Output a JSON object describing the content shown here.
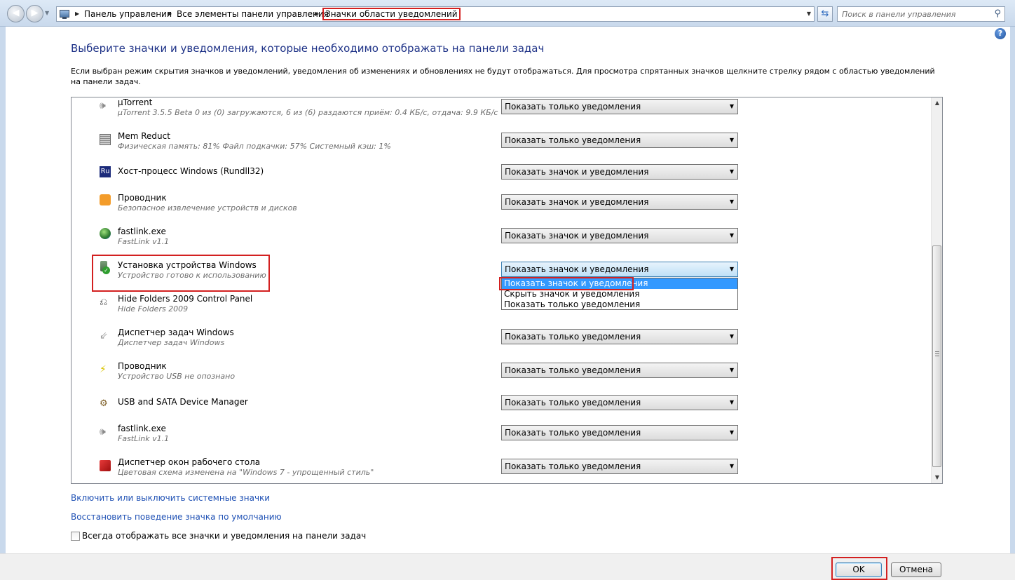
{
  "address": {
    "crumbs": [
      "Панель управления",
      "Все элементы панели управления",
      "Значки области уведомлений"
    ],
    "search_placeholder": "Поиск в панели управления"
  },
  "page": {
    "title": "Выберите значки и уведомления, которые необходимо отображать на панели задач",
    "description": "Если выбран режим скрытия значков и уведомлений, уведомления об изменениях и обновлениях не будут отображаться. Для просмотра спрятанных значков щелкните стрелку рядом с областью уведомлений на панели задач."
  },
  "rows": [
    {
      "name": "µTorrent",
      "sub": "µTorrent 3.5.5 Beta  0 из (0) загружаются, 6 из (6) раздаются  приём: 0.4 КБ/с, отдача: 9.9 КБ/с",
      "value": "Показать только уведомления",
      "icon": "speaker-icon"
    },
    {
      "name": "Mem Reduct",
      "sub": "Физическая память: 81%  Файл подкачки: 57%  Системный кэш: 1%",
      "value": "Показать только уведомления",
      "icon": "memory-icon"
    },
    {
      "name": "Хост-процесс Windows (Rundll32)",
      "sub": "",
      "value": "Показать значок и уведомления",
      "icon": "ru-language-icon"
    },
    {
      "name": "Проводник",
      "sub": "Безопасное извлечение устройств и дисков",
      "value": "Показать значок и уведомления",
      "icon": "explorer-icon"
    },
    {
      "name": "fastlink.exe",
      "sub": "FastLink v1.1",
      "value": "Показать значок и уведомления",
      "icon": "globe-icon"
    },
    {
      "name": "Установка устройства Windows",
      "sub": "Устройство готово к использованию",
      "value": "Показать значок и уведомления",
      "icon": "usb-device-ok-icon"
    },
    {
      "name": "Hide Folders 2009 Control Panel",
      "sub": "Hide Folders 2009",
      "value": "",
      "icon": "plug-icon"
    },
    {
      "name": "Диспетчер задач Windows",
      "sub": "Диспетчер задач Windows",
      "value": "Показать только уведомления",
      "icon": "task-manager-icon"
    },
    {
      "name": "Проводник",
      "sub": "Устройство USB не опознано",
      "value": "Показать только уведомления",
      "icon": "usb-warning-icon"
    },
    {
      "name": "USB and SATA Device Manager",
      "sub": "",
      "value": "Показать только уведомления",
      "icon": "chip-icon"
    },
    {
      "name": "fastlink.exe",
      "sub": "FastLink v1.1",
      "value": "Показать только уведомления",
      "icon": "speaker-icon"
    },
    {
      "name": "Диспетчер окон рабочего стола",
      "sub": "Цветовая схема изменена на \"Windows 7 - упрощенный стиль\"",
      "value": "Показать только уведомления",
      "icon": "dwm-icon"
    }
  ],
  "dropdown_options": [
    "Показать значок и уведомления",
    "Скрыть значок и уведомления",
    "Показать только уведомления"
  ],
  "links": {
    "system_icons": "Включить или выключить системные значки",
    "restore_default": "Восстановить поведение значка по умолчанию"
  },
  "always_show_label": "Всегда отображать все значки и уведомления на панели задач",
  "buttons": {
    "ok": "OK",
    "cancel": "Отмена"
  },
  "colors": {
    "highlight_frame": "#d32020",
    "link": "#1e50b4",
    "title": "#1e3287",
    "selection": "#3399ff"
  }
}
